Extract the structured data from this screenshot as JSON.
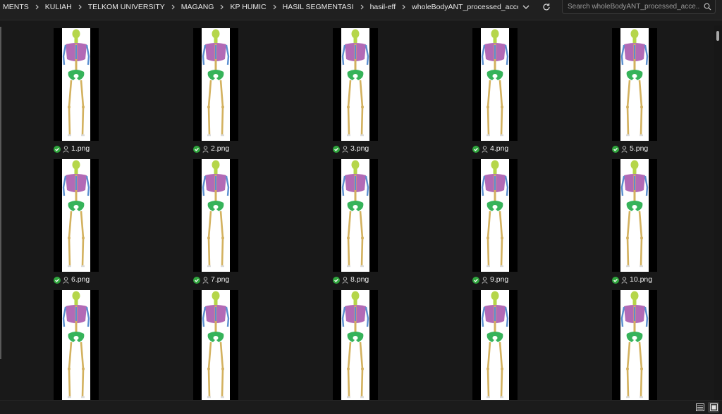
{
  "breadcrumb": [
    "MENTS",
    "KULIAH",
    "TELKOM UNIVERSITY",
    "MAGANG",
    "KP HUMIC",
    "HASIL SEGMENTASI",
    "hasil-eff",
    "wholeBodyANT_processed_accepted"
  ],
  "search": {
    "placeholder": "Search wholeBodyANT_processed_acce..."
  },
  "files": [
    {
      "name": "1.png"
    },
    {
      "name": "2.png"
    },
    {
      "name": "3.png"
    },
    {
      "name": "4.png"
    },
    {
      "name": "5.png"
    },
    {
      "name": "6.png"
    },
    {
      "name": "7.png"
    },
    {
      "name": "8.png"
    },
    {
      "name": "9.png"
    },
    {
      "name": "10.png"
    },
    {
      "name": ""
    },
    {
      "name": ""
    },
    {
      "name": ""
    },
    {
      "name": ""
    },
    {
      "name": ""
    }
  ],
  "icons": {
    "dropdown": "chevron-down-icon",
    "refresh": "refresh-icon",
    "search": "search-icon",
    "status": "sync-ok-check-icon",
    "shared": "person-icon",
    "details_view": "details-view-icon",
    "tiles_view": "large-icons-view-icon"
  },
  "colors": {
    "background": "#191919",
    "status_ok": "#2fa53d",
    "skull": "#b5d64a",
    "thorax": "#b26ab6",
    "spine": "#5a8fd0",
    "pelvis": "#36b35a",
    "limbs": "#d3b15e"
  }
}
